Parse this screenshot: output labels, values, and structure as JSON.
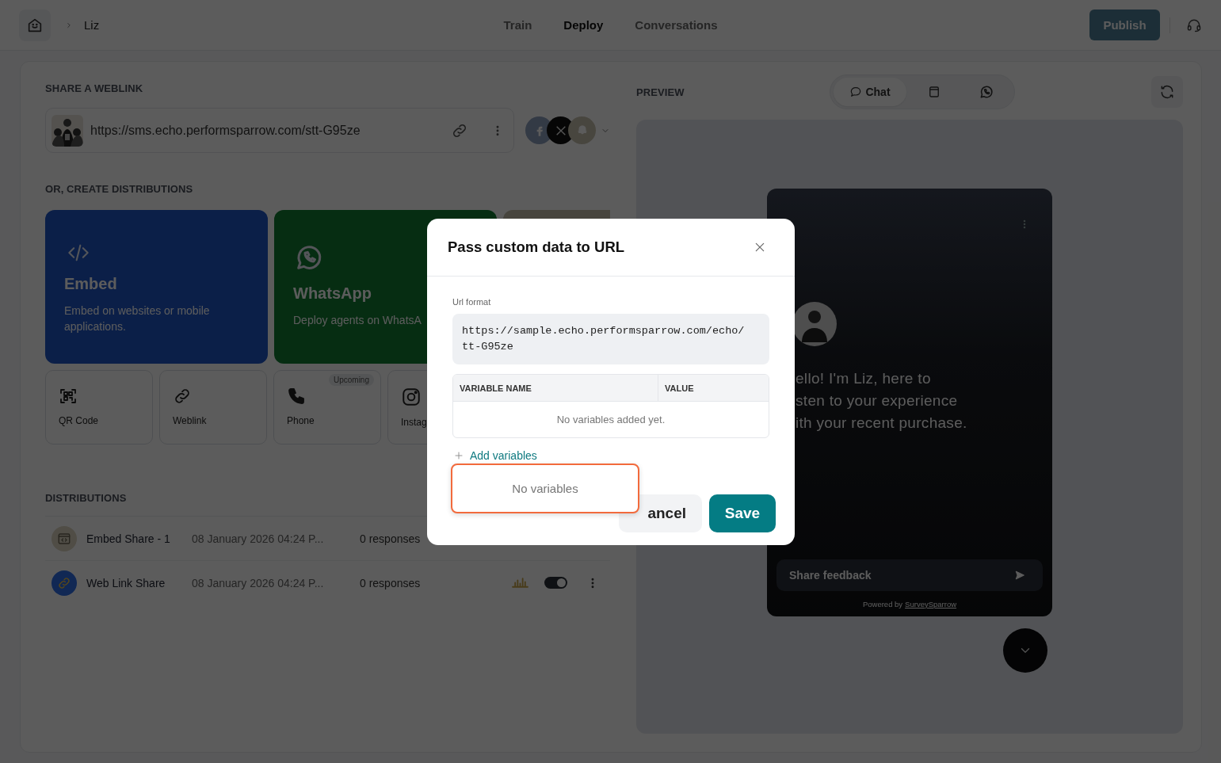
{
  "header": {
    "breadcrumb": "Liz",
    "nav": [
      {
        "label": "Train",
        "selected": false
      },
      {
        "label": "Deploy",
        "selected": true
      },
      {
        "label": "Conversations",
        "selected": false
      }
    ],
    "publish_button": "Publish"
  },
  "share": {
    "heading": "SHARE A WEBLINK",
    "url": "https://sms.echo.performsparrow.com/stt-G95ze"
  },
  "create": {
    "heading": "OR, CREATE DISTRIBUTIONS",
    "big_cards": [
      {
        "kind": "embed",
        "title": "Embed",
        "description": "Embed on websites or mobile applications."
      },
      {
        "kind": "whatsapp",
        "title": "WhatsApp",
        "description": "Deploy agents on WhatsA"
      },
      {
        "kind": "more"
      }
    ],
    "small_cards": [
      {
        "kind": "qr",
        "label": "QR Code"
      },
      {
        "kind": "weblink",
        "label": "Weblink"
      },
      {
        "kind": "phone",
        "label": "Phone",
        "badge": "Upcoming"
      },
      {
        "kind": "instagram",
        "label": "Instag"
      }
    ]
  },
  "distributions": {
    "heading": "DISTRIBUTIONS",
    "rows": [
      {
        "kind": "embed",
        "name": "Embed Share - 1",
        "date": "08 January 2026 04:24 P...",
        "responses": "0 responses"
      },
      {
        "kind": "weblink",
        "name": "Web Link Share",
        "date": "08 January 2026 04:24 P...",
        "responses": "0 responses",
        "on": true
      }
    ]
  },
  "preview": {
    "heading": "PREVIEW",
    "tabs": [
      {
        "kind": "chat",
        "label": "Chat",
        "selected": true
      },
      {
        "kind": "web",
        "selected": false
      },
      {
        "kind": "whatsapp",
        "selected": false
      }
    ],
    "greeting_lines": [
      "ello! I'm Liz, here to",
      "sten to your experience",
      "ith your recent purchase."
    ],
    "input_placeholder": "Share feedback",
    "powered_by": "Powered by",
    "powered_link": "SurveySparrow"
  },
  "modal": {
    "title": "Pass custom data to URL",
    "url_label": "Url format",
    "url_lines": [
      "https://sample.echo.performsparrow.com/echo/",
      "tt-G95ze"
    ],
    "columns": [
      "VARIABLE NAME",
      "VALUE"
    ],
    "empty_text": "No variables added yet.",
    "add_link": "Add variables",
    "dropdown_text": "No variables",
    "cancel_button": "ancel",
    "save_button": "Save"
  }
}
